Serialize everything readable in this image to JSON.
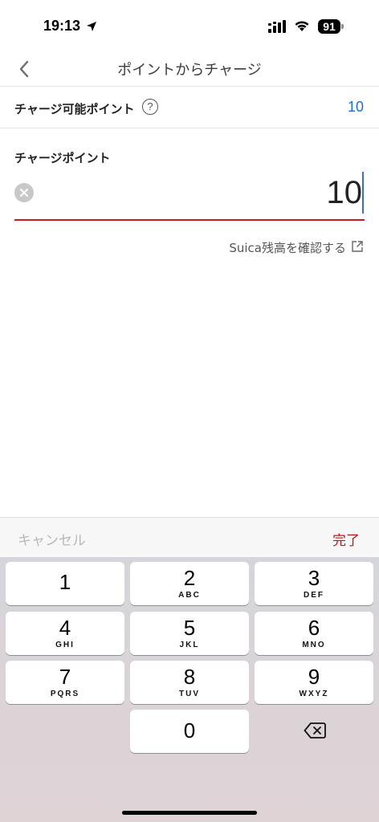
{
  "status_bar": {
    "time": "19:13",
    "battery": "91",
    "location_icon": "location-arrow-icon",
    "cellular_icon": "cellular-signal-icon",
    "wifi_icon": "wifi-icon"
  },
  "nav": {
    "title": "ポイントからチャージ",
    "back_icon": "chevron-left-icon"
  },
  "available": {
    "label": "チャージ可能ポイント",
    "help_icon_text": "?",
    "value": "10"
  },
  "charge": {
    "label": "チャージポイント",
    "value": "10",
    "clear_icon": "clear-icon"
  },
  "suica_link": {
    "text": "Suica残高を確認する",
    "icon": "external-link-icon"
  },
  "keyboard_toolbar": {
    "cancel": "キャンセル",
    "done": "完了"
  },
  "keypad": {
    "keys": [
      {
        "num": "1",
        "letters": ""
      },
      {
        "num": "2",
        "letters": "ABC"
      },
      {
        "num": "3",
        "letters": "DEF"
      },
      {
        "num": "4",
        "letters": "GHI"
      },
      {
        "num": "5",
        "letters": "JKL"
      },
      {
        "num": "6",
        "letters": "MNO"
      },
      {
        "num": "7",
        "letters": "PQRS"
      },
      {
        "num": "8",
        "letters": "TUV"
      },
      {
        "num": "9",
        "letters": "WXYZ"
      },
      {
        "num": "0",
        "letters": ""
      }
    ],
    "delete_icon": "backspace-icon"
  },
  "colors": {
    "accent_red": "#d0161b",
    "link_blue": "#1a6fd6",
    "caret_blue": "#2f6fe0"
  }
}
